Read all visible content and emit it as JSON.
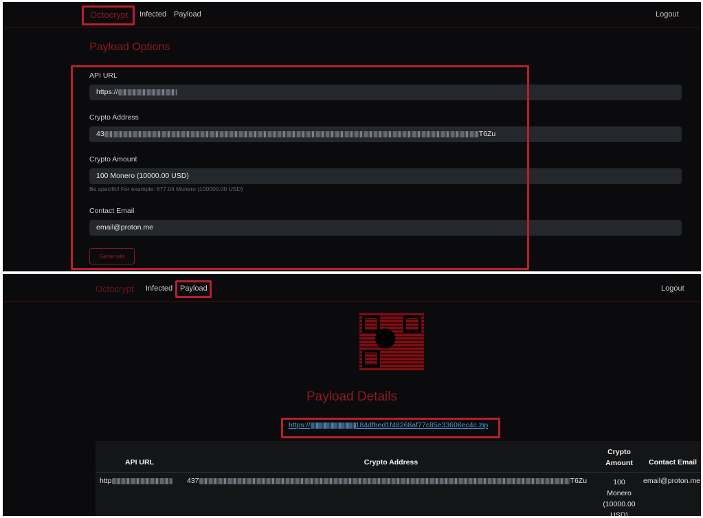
{
  "top": {
    "nav": {
      "brand": "Octocrypt",
      "links": [
        "Infected",
        "Payload"
      ],
      "logout": "Logout"
    },
    "heading": "Payload Options",
    "fields": {
      "api_url": {
        "label": "API URL",
        "value": "https://"
      },
      "crypto_address": {
        "label": "Crypto Address",
        "prefix": "43",
        "suffix": "T6Zu"
      },
      "crypto_amount": {
        "label": "Crypto Amount",
        "value": "100 Monero (10000.00 USD)",
        "hint": "Be specific! For example: 677.04 Monero (100000.00 USD)"
      },
      "contact_email": {
        "label": "Contact Email",
        "value": "email@proton.me"
      }
    },
    "generate_label": "Generate"
  },
  "bottom": {
    "nav": {
      "brand": "Octocrypt",
      "links": [
        "Infected",
        "Payload"
      ],
      "logout": "Logout"
    },
    "title": "Payload Details",
    "zip_link": {
      "prefix": "https://",
      "suffix": "184dfbed1f48268af77c85e33606ec4c.zip"
    },
    "table": {
      "headers": [
        "API URL",
        "Crypto Address",
        "Crypto Amount",
        "Contact Email"
      ],
      "row": {
        "api_url_prefix": "http",
        "crypto_prefix": "437",
        "crypto_suffix": "T6Zu",
        "amount_lines": [
          "100",
          "Monero",
          "(10000.00",
          "USD)"
        ],
        "email": "email@proton.me"
      }
    }
  },
  "colors": {
    "accent": "#8e1a1f",
    "highlight": "#b81f2a",
    "background": "#0b0b0d",
    "field": "#24272c"
  }
}
